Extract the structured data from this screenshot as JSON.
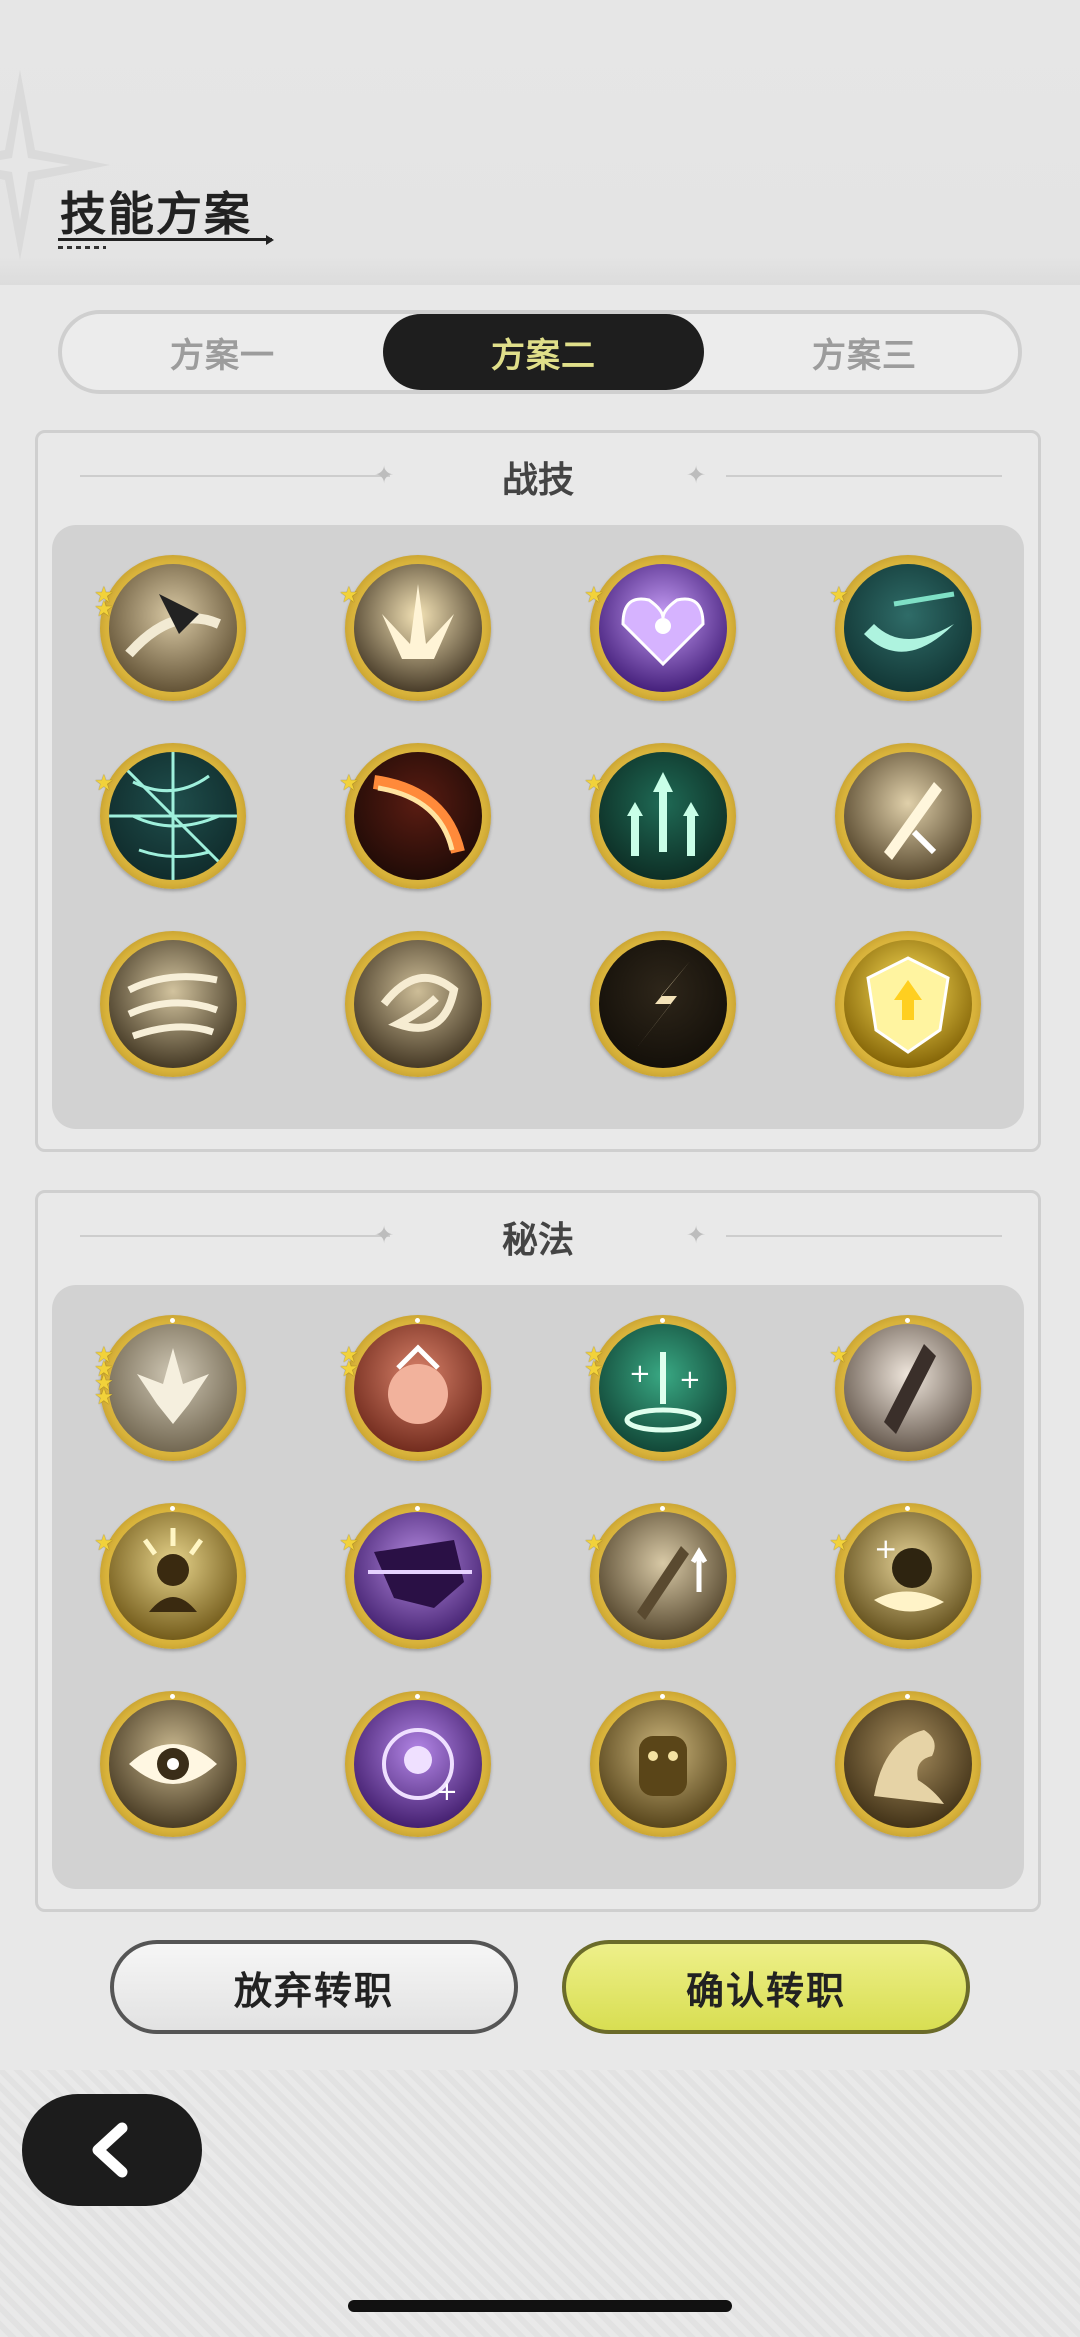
{
  "header": {
    "title": "技能方案"
  },
  "tabs": [
    {
      "label": "方案一",
      "active": false
    },
    {
      "label": "方案二",
      "active": true
    },
    {
      "label": "方案三",
      "active": false
    }
  ],
  "combat_skills": {
    "title": "战技",
    "items": [
      {
        "icon": "claw-slash-icon",
        "stars": 2
      },
      {
        "icon": "ground-burst-icon",
        "stars": 1
      },
      {
        "icon": "purple-heart-icon",
        "stars": 1
      },
      {
        "icon": "teal-crescent-icon",
        "stars": 1
      },
      {
        "icon": "spider-web-icon",
        "stars": 1
      },
      {
        "icon": "fire-slash-icon",
        "stars": 1
      },
      {
        "icon": "green-arrows-icon",
        "stars": 1
      },
      {
        "icon": "sword-strike-icon",
        "stars": 0
      },
      {
        "icon": "wind-gust-icon",
        "stars": 0
      },
      {
        "icon": "whirlwind-icon",
        "stars": 0
      },
      {
        "icon": "lightning-slash-icon",
        "stars": 0
      },
      {
        "icon": "golden-shield-icon",
        "stars": 0
      }
    ]
  },
  "secret_arts": {
    "title": "秘法",
    "items": [
      {
        "icon": "leaf-emblem-icon",
        "stars": 4
      },
      {
        "icon": "red-creature-icon",
        "stars": 2
      },
      {
        "icon": "heal-ring-icon",
        "stars": 2
      },
      {
        "icon": "crystal-shard-icon",
        "stars": 1
      },
      {
        "icon": "golden-figure-icon",
        "stars": 1
      },
      {
        "icon": "purple-beast-icon",
        "stars": 1
      },
      {
        "icon": "sword-buff-icon",
        "stars": 1
      },
      {
        "icon": "heal-guard-icon",
        "stars": 1
      },
      {
        "icon": "eye-icon",
        "stars": 0
      },
      {
        "icon": "purple-orb-icon",
        "stars": 0
      },
      {
        "icon": "golem-icon",
        "stars": 0
      },
      {
        "icon": "dragon-icon",
        "stars": 0
      }
    ]
  },
  "buttons": {
    "cancel": "放弃转职",
    "confirm": "确认转职"
  },
  "nav": {
    "back_icon": "chevron-left-icon"
  },
  "colors": {
    "accent_tab_text": "#e0df8a",
    "confirm_fill": "#d8de52",
    "ring_gold": "#d8b23a"
  }
}
